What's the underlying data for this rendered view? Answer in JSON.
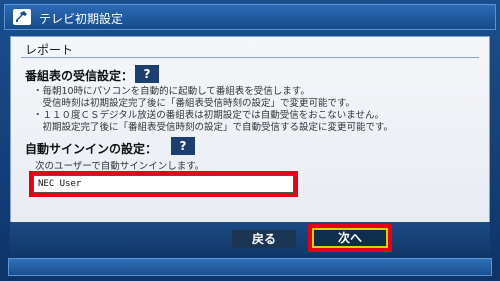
{
  "window": {
    "title": "テレビ初期設定",
    "icon": "tool-icon"
  },
  "panel": {
    "heading": "レポート",
    "sections": [
      {
        "title": "番組表の受信設定：",
        "help": "?",
        "notes": [
          "・毎朝10時にパソコンを自動的に起動して番組表を受信します。",
          "　受信時刻は初期設定完了後に「番組表受信時刻の設定」で変更可能です。",
          "・１１０度ＣＳデジタル放送の番組表は初期設定では自動受信をおこないません。",
          "　初期設定完了後に「番組表受信時刻の設定」で自動受信する設定に変更可能です。"
        ]
      },
      {
        "title": "自動サインインの設定：",
        "help": "?",
        "subtext": "次のユーザーで自動サインインします。",
        "user_value": "NEC User"
      }
    ]
  },
  "buttons": {
    "back": "戻る",
    "next": "次へ"
  },
  "colors": {
    "highlight": "#e60012",
    "focus_border": "#d8d200",
    "panel_bg": "#f4f6f9",
    "frame_bg": "#1a4f8f"
  }
}
